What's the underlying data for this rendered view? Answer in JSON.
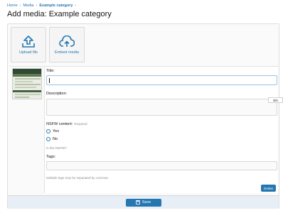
{
  "breadcrumb": {
    "home": "Home",
    "media": "Media",
    "category": "Example category",
    "sep": "›"
  },
  "page": {
    "title": "Add media: Example category"
  },
  "tiles": {
    "upload": "Upload file",
    "embed": "Embed media"
  },
  "form": {
    "title_label": "Title:",
    "description_label": "Description:",
    "nsfw_label": "NSFW content:",
    "required": "Required",
    "yes": "Yes",
    "no": "No",
    "nsfw_hint": "Is this NSFW?",
    "tags_label": "Tags:",
    "tags_hint": "Multiple tags may be separated by commas.",
    "delete": "Delete"
  },
  "lang_badge": "EN",
  "footer": {
    "save": "Save"
  },
  "colors": {
    "accent": "#2577b1"
  }
}
